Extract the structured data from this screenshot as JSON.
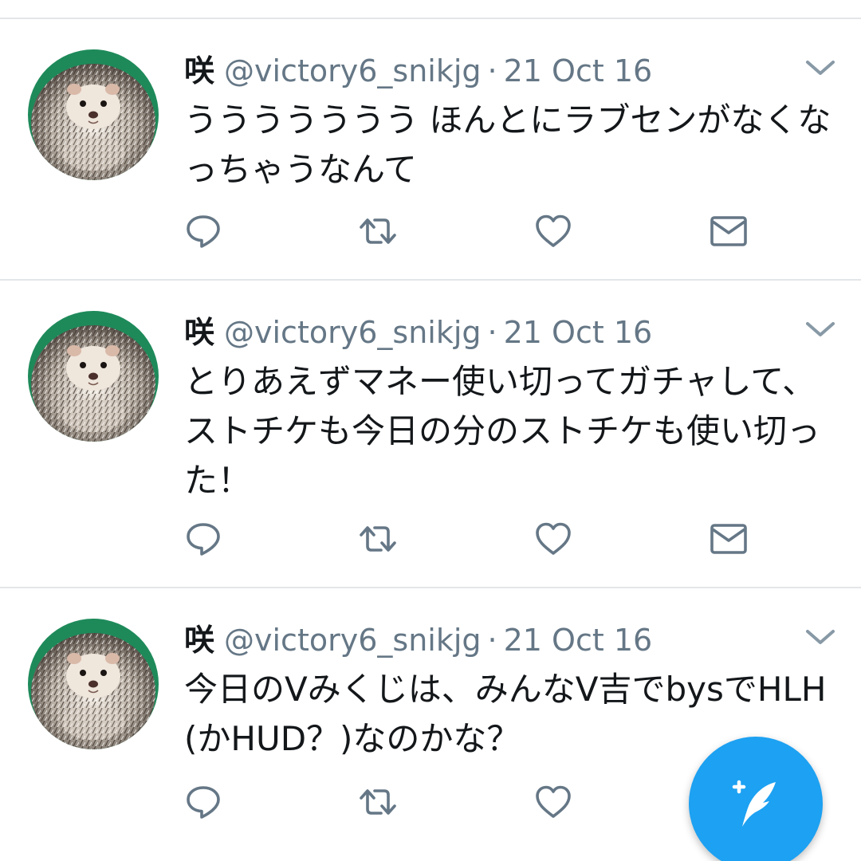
{
  "tweets": [
    {
      "name": "咲",
      "handle": "@victory6_snikjg",
      "separator": "·",
      "date": "21 Oct 16",
      "text": "ううううううう ほんとにラブセンがなくなっちゃうなんて",
      "has_dm": true
    },
    {
      "name": "咲",
      "handle": "@victory6_snikjg",
      "separator": "·",
      "date": "21 Oct 16",
      "text": "とりあえずマネー使い切ってガチャして、ストチケも今日の分のストチケも使い切った！",
      "has_dm": true
    },
    {
      "name": "咲",
      "handle": "@victory6_snikjg",
      "separator": "·",
      "date": "21 Oct 16",
      "text": "今日のVみくじは、みんなV吉でbysでHLH(かHUD？)なのかな？",
      "has_dm": false
    }
  ],
  "icons": {
    "reply": "speech-bubble-icon",
    "retweet": "retweet-arrows-icon",
    "like": "heart-icon",
    "dm": "envelope-icon",
    "caret": "chevron-down-icon",
    "compose": "compose-quill-icon"
  },
  "colors": {
    "text_primary": "#14171a",
    "text_secondary": "#657786",
    "icon_gray": "#657786",
    "accent": "#1da1f2",
    "divider": "#e3e6e8",
    "avatar_ring": "#1e8a5a"
  }
}
